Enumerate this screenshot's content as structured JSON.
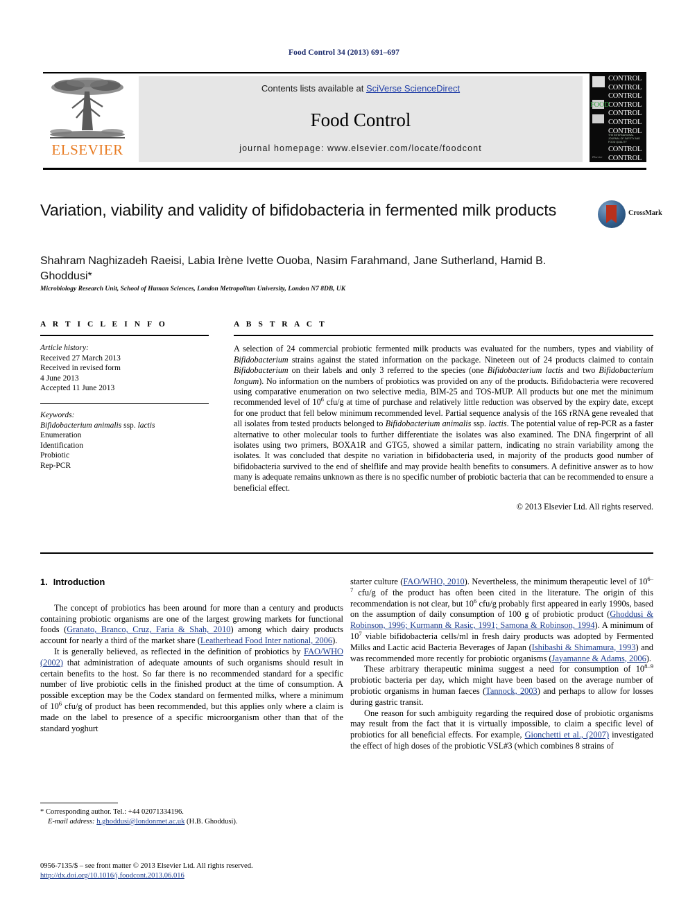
{
  "running_head": "Food Control 34 (2013) 691–697",
  "banner": {
    "contents_prefix": "Contents lists available at ",
    "contents_link": "SciVerse ScienceDirect",
    "journal_title": "Food Control",
    "homepage": "journal homepage: www.elsevier.com/locate/foodcont",
    "publisher_wordmark": "ELSEVIER",
    "cover": {
      "food_label": "FOOD",
      "control_label": "CONTROL",
      "control_rows": 9,
      "subtitle": "THE INTERNATIONAL JOURNAL OF SAFETY AND FOOD QUALITY",
      "footer": "Elsevier"
    }
  },
  "article": {
    "title": "Variation, viability and validity of bifidobacteria in fermented milk products",
    "authors": "Shahram Naghizadeh Raeisi, Labia Irène Ivette Ouoba, Nasim Farahmand, Jane Sutherland, Hamid B. Ghoddusi*",
    "affiliation": "Microbiology Research Unit, School of Human Sciences, London Metropolitan University, London N7 8DB, UK",
    "crossmark_label": "CrossMark"
  },
  "article_info": {
    "heading": "A R T I C L E   I N F O",
    "history_label": "Article history:",
    "history": [
      "Received 27 March 2013",
      "Received in revised form",
      "4 June 2013",
      "Accepted 11 June 2013"
    ],
    "keywords_label": "Keywords:",
    "keywords": [
      "Bifidobacterium animalis ssp. lactis",
      "Enumeration",
      "Identification",
      "Probiotic",
      "Rep-PCR"
    ]
  },
  "abstract": {
    "heading": "A B S T R A C T",
    "paragraph_parts": [
      "A selection of 24 commercial probiotic fermented milk products was evaluated for the numbers, types and viability of ",
      "Bifidobacterium",
      " strains against the stated information on the package. Nineteen out of 24 products claimed to contain ",
      "Bifidobacterium",
      " on their labels and only 3 referred to the species (one ",
      "Bifidobacterium lactis",
      " and two ",
      "Bifidobacterium longum",
      "). No information on the numbers of probiotics was provided on any of the products. Bifidobacteria were recovered using comparative enumeration on two selective media, BIM-25 and TOS-MUP. All products but one met the minimum recommended level of 10",
      "6",
      " cfu/g at time of purchase and relatively little reduction was observed by the expiry date, except for one product that fell below minimum recommended level. Partial sequence analysis of the 16S rRNA gene revealed that all isolates from tested products belonged to ",
      "Bifidobacterium animalis",
      " ssp. ",
      "lactis",
      ". The potential value of rep-PCR as a faster alternative to other molecular tools to further differentiate the isolates was also examined. The DNA fingerprint of all isolates using two primers, BOXA1R and GTG5, showed a similar pattern, indicating no strain variability among the isolates. It was concluded that despite no variation in bifidobacteria used, in majority of the products good number of bifidobacteria survived to the end of shelflife and may provide health benefits to consumers. A definitive answer as to how many is adequate remains unknown as there is no specific number of probiotic bacteria that can be recommended to ensure a beneficial effect."
    ],
    "copyright": "© 2013 Elsevier Ltd. All rights reserved."
  },
  "introduction": {
    "number": "1.",
    "title": "Introduction",
    "left_paragraphs": [
      {
        "parts": [
          {
            "t": "The concept of probiotics has been around for more than a century and products containing probiotic organisms are one of the largest growing markets for functional foods ("
          },
          {
            "t": "Granato, Branco, Cruz, Faria & Shah, 2010",
            "cite": true
          },
          {
            "t": ") among which dairy products account for nearly a third of the market share ("
          },
          {
            "t": "Leatherhead Food Inter national, 2006",
            "cite": true
          },
          {
            "t": ")."
          }
        ]
      },
      {
        "parts": [
          {
            "t": "It is generally believed, as reflected in the definition of probiotics by "
          },
          {
            "t": "FAO/WHO (2002)",
            "cite": true
          },
          {
            "t": " that administration of adequate amounts of such organisms should result in certain benefits to the host. So far there is no recommended standard for a specific number of live probiotic cells in the finished product at the time of consumption. A possible exception may be the Codex standard on fermented milks, where a minimum of 10"
          },
          {
            "t": "6",
            "sup": true
          },
          {
            "t": " cfu/g of product has been recommended, but this applies only where a claim is made on the label to presence of a specific microorganism other than that of the standard yoghurt"
          }
        ]
      }
    ],
    "right_paragraphs": [
      {
        "continued": true,
        "parts": [
          {
            "t": "starter culture ("
          },
          {
            "t": "FAO/WHO, 2010",
            "cite": true
          },
          {
            "t": "). Nevertheless, the minimum therapeutic level of 10"
          },
          {
            "t": "6–7",
            "sup": true
          },
          {
            "t": " cfu/g of the product has often been cited in the literature. The origin of this recommendation is not clear, but 10"
          },
          {
            "t": "6",
            "sup": true
          },
          {
            "t": " cfu/g probably first appeared in early 1990s, based on the assumption of daily consumption of 100 g of probiotic product ("
          },
          {
            "t": "Ghoddusi & Robinson, 1996; Kurmann & Rasic, 1991; Samona & Robinson, 1994",
            "cite": true
          },
          {
            "t": "). A minimum of 10"
          },
          {
            "t": "7",
            "sup": true
          },
          {
            "t": " viable bifidobacteria cells/ml in fresh dairy products was adopted by Fermented Milks and Lactic acid Bacteria Beverages of Japan ("
          },
          {
            "t": "Ishibashi & Shimamura, 1993",
            "cite": true
          },
          {
            "t": ") and was recommended more recently for probiotic organisms ("
          },
          {
            "t": "Jayamanne & Adams, 2006",
            "cite": true
          },
          {
            "t": ")."
          }
        ]
      },
      {
        "parts": [
          {
            "t": "These arbitrary therapeutic minima suggest a need for consumption of 10"
          },
          {
            "t": "8–9",
            "sup": true
          },
          {
            "t": " probiotic bacteria per day, which might have been based on the average number of probiotic organisms in human faeces ("
          },
          {
            "t": "Tannock, 2003",
            "cite": true
          },
          {
            "t": ") and perhaps to allow for losses during gastric transit."
          }
        ]
      },
      {
        "parts": [
          {
            "t": "One reason for such ambiguity regarding the required dose of probiotic organisms may result from the fact that it is virtually impossible, to claim a specific level of probiotics for all beneficial effects. For example, "
          },
          {
            "t": "Gionchetti et al., (2007)",
            "cite": true
          },
          {
            "t": " investigated the effect of high doses of the probiotic VSL#3 (which combines 8 strains of"
          }
        ]
      }
    ]
  },
  "footnotes": {
    "corresponding": "* Corresponding author. Tel.: +44 02071334196.",
    "email_label": "E-mail address:",
    "email": "h.ghoddusi@londonmet.ac.uk",
    "email_owner": "(H.B. Ghoddusi)."
  },
  "imprint": {
    "front_matter": "0956-7135/$ – see front matter © 2013 Elsevier Ltd. All rights reserved.",
    "doi": "http://dx.doi.org/10.1016/j.foodcont.2013.06.016"
  },
  "colors": {
    "running_head": "#1b2a6b",
    "link": "#2340a8",
    "citation": "#1b3a8c",
    "elsevier_orange": "#e87b22",
    "cover_green": "#3fa34a",
    "banner_bg": "#e6e6e6"
  }
}
